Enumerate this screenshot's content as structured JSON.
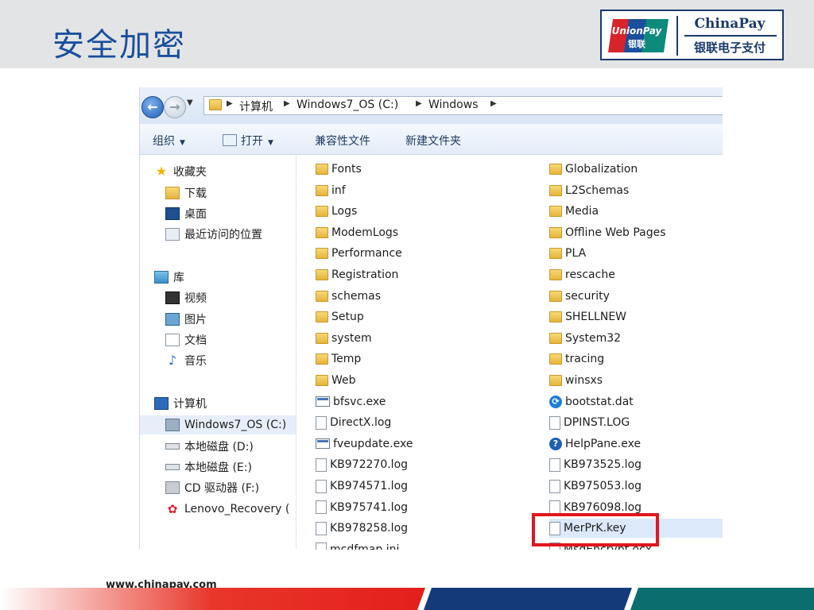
{
  "slide": {
    "title": "安全加密",
    "logo_unionpay_line1": "UnionPay",
    "logo_unionpay_line2": "银联",
    "logo_chinapay": "ChinaPay",
    "logo_chinapay_cn": "银联电子支付",
    "footer_url": "www.chinapay.com"
  },
  "explorer": {
    "breadcrumb": [
      "计算机",
      "Windows7_OS (C:)",
      "Windows"
    ],
    "toolbar": {
      "organize": "组织",
      "open": "打开",
      "compat_files": "兼容性文件",
      "new_folder": "新建文件夹"
    },
    "nav": [
      {
        "label": "收藏夹",
        "icon": "star-icon"
      },
      {
        "label": "下载",
        "icon": "download-folder-icon"
      },
      {
        "label": "桌面",
        "icon": "desktop-icon"
      },
      {
        "label": "最近访问的位置",
        "icon": "recent-places-icon"
      },
      {
        "label": "库",
        "icon": "library-icon"
      },
      {
        "label": "视频",
        "icon": "video-icon"
      },
      {
        "label": "图片",
        "icon": "pictures-icon"
      },
      {
        "label": "文档",
        "icon": "documents-icon"
      },
      {
        "label": "音乐",
        "icon": "music-icon"
      },
      {
        "label": "计算机",
        "icon": "computer-icon"
      },
      {
        "label": "Windows7_OS (C:)",
        "icon": "windows-drive-icon"
      },
      {
        "label": "本地磁盘 (D:)",
        "icon": "hard-disk-icon"
      },
      {
        "label": "本地磁盘 (E:)",
        "icon": "hard-disk-icon"
      },
      {
        "label": "CD 驱动器 (F:)",
        "icon": "cd-drive-icon"
      },
      {
        "label": "Lenovo_Recovery (",
        "icon": "recovery-drive-icon"
      }
    ],
    "files_col1": [
      {
        "name": "Fonts",
        "type": "folder"
      },
      {
        "name": "inf",
        "type": "folder"
      },
      {
        "name": "Logs",
        "type": "folder"
      },
      {
        "name": "ModemLogs",
        "type": "folder"
      },
      {
        "name": "Performance",
        "type": "folder"
      },
      {
        "name": "Registration",
        "type": "folder"
      },
      {
        "name": "schemas",
        "type": "folder"
      },
      {
        "name": "Setup",
        "type": "folder"
      },
      {
        "name": "system",
        "type": "folder"
      },
      {
        "name": "Temp",
        "type": "folder"
      },
      {
        "name": "Web",
        "type": "folder"
      },
      {
        "name": "bfsvc.exe",
        "type": "exe"
      },
      {
        "name": "DirectX.log",
        "type": "doc"
      },
      {
        "name": "fveupdate.exe",
        "type": "exe"
      },
      {
        "name": "KB972270.log",
        "type": "doc"
      },
      {
        "name": "KB974571.log",
        "type": "doc"
      },
      {
        "name": "KB975741.log",
        "type": "doc"
      },
      {
        "name": "KB978258.log",
        "type": "doc"
      },
      {
        "name": "mcdfmap.ini",
        "type": "doc"
      }
    ],
    "files_col2": [
      {
        "name": "Globalization",
        "type": "folder"
      },
      {
        "name": "L2Schemas",
        "type": "folder"
      },
      {
        "name": "Media",
        "type": "folder"
      },
      {
        "name": "Offline Web Pages",
        "type": "folder"
      },
      {
        "name": "PLA",
        "type": "folder"
      },
      {
        "name": "rescache",
        "type": "folder"
      },
      {
        "name": "security",
        "type": "folder"
      },
      {
        "name": "SHELLNEW",
        "type": "folder"
      },
      {
        "name": "System32",
        "type": "folder"
      },
      {
        "name": "tracing",
        "type": "folder"
      },
      {
        "name": "winsxs",
        "type": "folder"
      },
      {
        "name": "bootstat.dat",
        "type": "dat"
      },
      {
        "name": "DPINST.LOG",
        "type": "doc"
      },
      {
        "name": "HelpPane.exe",
        "type": "help"
      },
      {
        "name": "KB973525.log",
        "type": "doc"
      },
      {
        "name": "KB975053.log",
        "type": "doc"
      },
      {
        "name": "KB976098.log",
        "type": "doc"
      },
      {
        "name": "MerPrK.key",
        "type": "doc",
        "selected": true
      },
      {
        "name": "MsgEncrypt.ocx",
        "type": "doc"
      }
    ],
    "colors": {
      "highlight": "#e2161d",
      "selected_row": "#dbe9fb"
    }
  }
}
